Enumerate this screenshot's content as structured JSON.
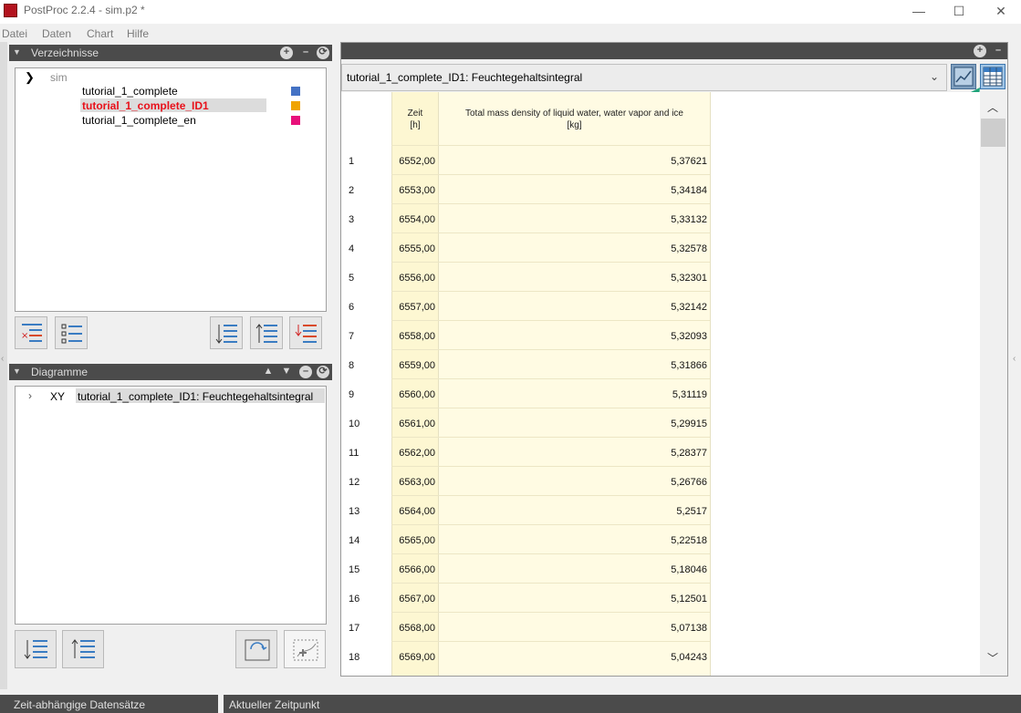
{
  "window": {
    "title": "PostProc 2.2.4 - sim.p2 *",
    "controls": [
      "—",
      "☐",
      "✕"
    ]
  },
  "menu": [
    "Datei",
    "Daten",
    "Chart",
    "Hilfe"
  ],
  "directories": {
    "title": "Verzeichnisse",
    "root": "sim",
    "items": [
      {
        "label": "tutorial_1_complete",
        "color": "#4472c4",
        "selected": false
      },
      {
        "label": "tutorial_1_complete_ID1",
        "color": "#f0a300",
        "selected": true
      },
      {
        "label": "tutorial_1_complete_en",
        "color": "#e8107a",
        "selected": false
      }
    ]
  },
  "diagrams": {
    "title": "Diagramme",
    "items": [
      {
        "type": "XY",
        "label": "tutorial_1_complete_ID1: Feuchtegehaltsintegral"
      }
    ]
  },
  "chart": {
    "selector": "tutorial_1_complete_ID1: Feuchtegehaltsintegral",
    "table": {
      "columns": [
        {
          "title": "Zeit",
          "unit": "[h]"
        },
        {
          "title": "Total mass density of liquid water, water vapor and ice",
          "unit": "[kg]"
        }
      ],
      "rows": [
        {
          "n": "1",
          "zeit": "6552,00",
          "value": "5,37621"
        },
        {
          "n": "2",
          "zeit": "6553,00",
          "value": "5,34184"
        },
        {
          "n": "3",
          "zeit": "6554,00",
          "value": "5,33132"
        },
        {
          "n": "4",
          "zeit": "6555,00",
          "value": "5,32578"
        },
        {
          "n": "5",
          "zeit": "6556,00",
          "value": "5,32301"
        },
        {
          "n": "6",
          "zeit": "6557,00",
          "value": "5,32142"
        },
        {
          "n": "7",
          "zeit": "6558,00",
          "value": "5,32093"
        },
        {
          "n": "8",
          "zeit": "6559,00",
          "value": "5,31866"
        },
        {
          "n": "9",
          "zeit": "6560,00",
          "value": "5,31119"
        },
        {
          "n": "10",
          "zeit": "6561,00",
          "value": "5,29915"
        },
        {
          "n": "11",
          "zeit": "6562,00",
          "value": "5,28377"
        },
        {
          "n": "12",
          "zeit": "6563,00",
          "value": "5,26766"
        },
        {
          "n": "13",
          "zeit": "6564,00",
          "value": "5,2517"
        },
        {
          "n": "14",
          "zeit": "6565,00",
          "value": "5,22518"
        },
        {
          "n": "15",
          "zeit": "6566,00",
          "value": "5,18046"
        },
        {
          "n": "16",
          "zeit": "6567,00",
          "value": "5,12501"
        },
        {
          "n": "17",
          "zeit": "6568,00",
          "value": "5,07138"
        },
        {
          "n": "18",
          "zeit": "6569,00",
          "value": "5,04243"
        }
      ]
    }
  },
  "status": {
    "left": "Zeit-abhängige Datensätze",
    "right": "Aktueller Zeitpunkt"
  },
  "colors": {
    "selected_text": "#e8101a",
    "annotation_arrow": "#1fa37a"
  }
}
